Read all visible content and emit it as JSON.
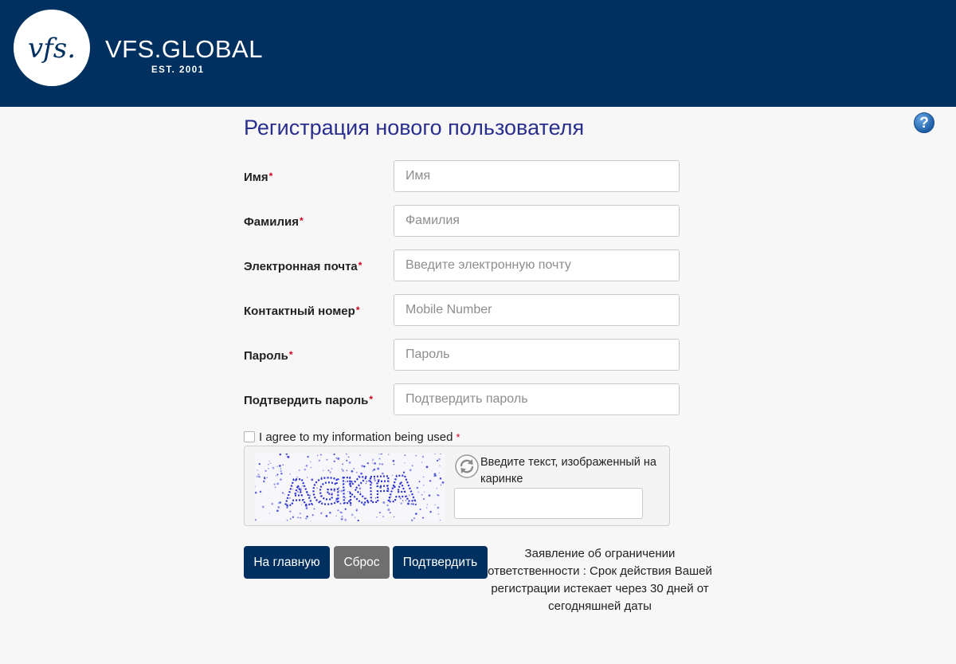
{
  "header": {
    "logo_text": "vfs.",
    "brand_name": "VFS.GLOBAL",
    "brand_est": "EST. 2001",
    "background_color": "#00305f"
  },
  "help": {
    "icon": "question-circle-icon",
    "label": "?"
  },
  "page": {
    "title": "Регистрация нового пользователя"
  },
  "form": {
    "required_mark": "*",
    "fields": [
      {
        "label": "Имя",
        "placeholder": "Имя",
        "value": ""
      },
      {
        "label": "Фамилия",
        "placeholder": "Фамилия",
        "value": ""
      },
      {
        "label": "Электронная почта",
        "placeholder": "Введите электронную почту",
        "value": ""
      },
      {
        "label": "Контактный номер",
        "placeholder": "Mobile Number",
        "value": ""
      },
      {
        "label": "Пароль",
        "placeholder": "Пароль",
        "value": ""
      },
      {
        "label": "Подтвердить пароль",
        "placeholder": "Подтвердить пароль",
        "value": ""
      }
    ],
    "agree_label": "I agree to my information being used",
    "agree_checked": false
  },
  "captcha": {
    "image_text": "AGKFA",
    "refresh_icon": "refresh-icon",
    "prompt": "Введите текст, изображенный на каринке",
    "value": ""
  },
  "buttons": {
    "home": "На главную",
    "reset": "Сброс",
    "submit": "Подтвердить"
  },
  "disclaimer": "Заявление об ограничении ответственности : Срок действия Вашей регистрации истекает через 30 дней от сегодняшней даты",
  "colors": {
    "primary": "#00305f",
    "title": "#2a2f8f",
    "required": "#d0021b",
    "reset_button": "#6f6f6f"
  }
}
